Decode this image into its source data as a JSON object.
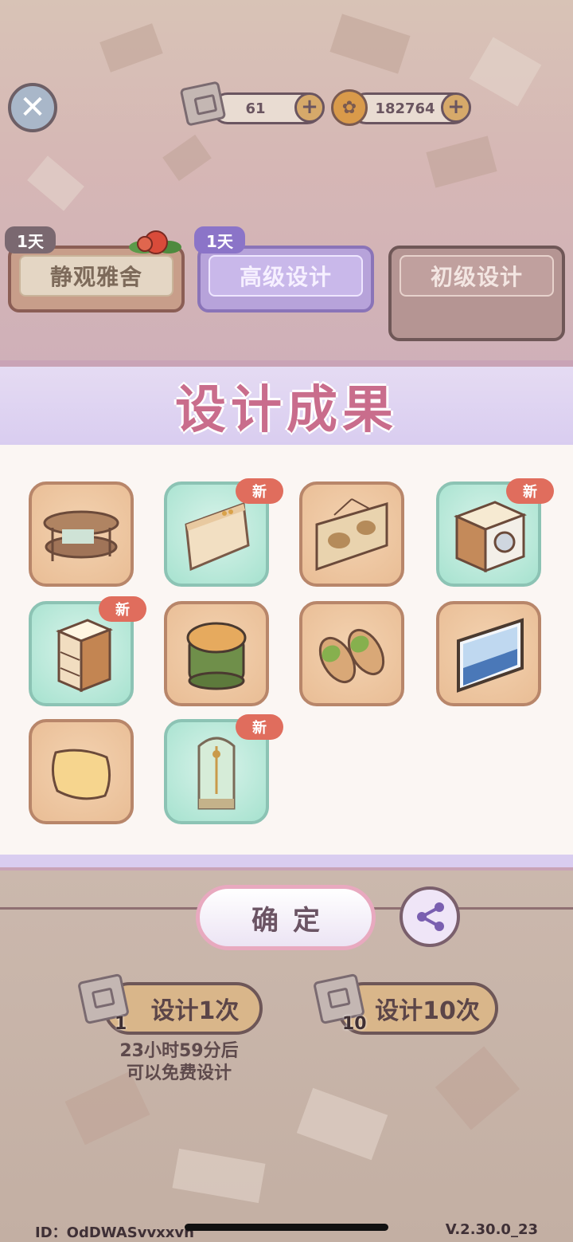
{
  "resources": {
    "scroll_count": "61",
    "coin_count": "182764",
    "plus_symbol": "+",
    "scroll_icon": "scroll-icon",
    "coin_icon": "coin-icon"
  },
  "close_symbol": "✕",
  "tabs": [
    {
      "label": "静观雅舍",
      "badge": "1天"
    },
    {
      "label": "高级设计",
      "badge": "1天"
    },
    {
      "label": "初级设计"
    }
  ],
  "panel": {
    "title": "设计成果",
    "new_badge": "新",
    "items": [
      {
        "name": "oval-shelf",
        "rare": false,
        "is_new": false
      },
      {
        "name": "wall-panel",
        "rare": true,
        "is_new": true
      },
      {
        "name": "map-painting",
        "rare": false,
        "is_new": false
      },
      {
        "name": "washing-machine-cabinet",
        "rare": true,
        "is_new": true
      },
      {
        "name": "lit-shelf",
        "rare": true,
        "is_new": true
      },
      {
        "name": "round-stool",
        "rare": false,
        "is_new": false
      },
      {
        "name": "slippers",
        "rare": false,
        "is_new": false
      },
      {
        "name": "sea-painting",
        "rare": false,
        "is_new": false
      },
      {
        "name": "cushion-pillow",
        "rare": false,
        "is_new": false
      },
      {
        "name": "shower-stall",
        "rare": true,
        "is_new": true
      }
    ]
  },
  "confirm_label": "确定",
  "design_once": {
    "label": "设计1次",
    "cost": "1"
  },
  "design_ten": {
    "label": "设计10次",
    "cost": "10"
  },
  "free_timer_line1": "23小时59分后",
  "free_timer_line2": "可以免费设计",
  "footer": {
    "id": "ID：OdDWASvvxxvn",
    "version": "V.2.30.0_23"
  },
  "colors": {
    "title_pink": "#c96d8c",
    "new_badge_red": "#e06d5d",
    "common_frame": "#b8866a",
    "rare_frame": "#8cc3b4"
  }
}
